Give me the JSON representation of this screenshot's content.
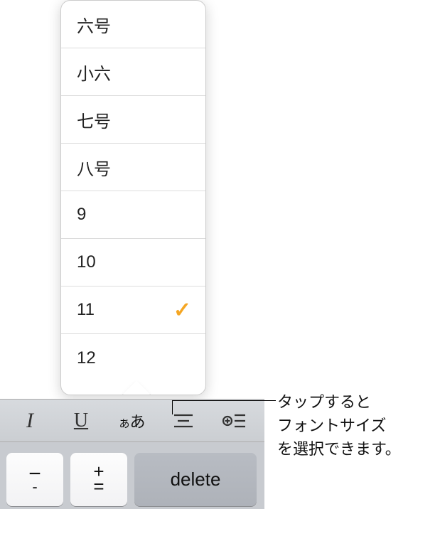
{
  "fontSizePopup": {
    "items": [
      {
        "label": "六号",
        "selected": false
      },
      {
        "label": "小六",
        "selected": false
      },
      {
        "label": "七号",
        "selected": false
      },
      {
        "label": "八号",
        "selected": false
      },
      {
        "label": "9",
        "selected": false
      },
      {
        "label": "10",
        "selected": false
      },
      {
        "label": "11",
        "selected": true
      },
      {
        "label": "12",
        "selected": false
      }
    ],
    "checkmarkGlyph": "✓"
  },
  "toolbar": {
    "italic": "I",
    "underline": "U",
    "fontsizeSmall": "あ",
    "fontsizeLarge": "あ"
  },
  "keyboard": {
    "minusTop": "−",
    "minusBottom": "-",
    "plus": "+",
    "equals": "=",
    "delete": "delete"
  },
  "callout": {
    "line1": "タップすると",
    "line2": "フォントサイズ",
    "line3": "を選択できます。"
  }
}
